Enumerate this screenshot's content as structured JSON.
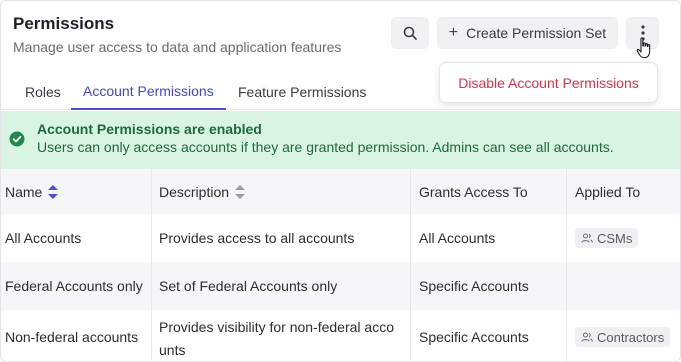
{
  "header": {
    "title": "Permissions",
    "subtitle": "Manage user access to data and application features",
    "create_label": "Create Permission Set"
  },
  "menu": {
    "disable_label": "Disable Account Permissions"
  },
  "tabs": [
    {
      "label": "Roles",
      "active": false
    },
    {
      "label": "Account Permissions",
      "active": true
    },
    {
      "label": "Feature Permissions",
      "active": false
    }
  ],
  "banner": {
    "title": "Account Permissions are enabled",
    "text": "Users can only access accounts if they are granted permission. Admins can see all accounts."
  },
  "table": {
    "columns": [
      "Name",
      "Description",
      "Grants Access To",
      "Applied To"
    ],
    "rows": [
      {
        "name": "All Accounts",
        "description": "Provides access to all accounts",
        "grants": "All Accounts",
        "applied": "CSMs"
      },
      {
        "name": "Federal Accounts only",
        "description": "Set of Federal Accounts only",
        "grants": "Specific Accounts",
        "applied": ""
      },
      {
        "name": "Non-federal accounts",
        "description_line1": "Provides visibility for non-federal acco",
        "description_line2": "unts",
        "grants": "Specific Accounts",
        "applied": "Contractors"
      }
    ]
  },
  "colors": {
    "accent": "#4a50c9",
    "danger": "#d3374a",
    "success_bg": "#d9f4e3",
    "success_text": "#1d6a3c"
  },
  "icons": {
    "search": "search-icon",
    "plus": "plus-icon",
    "more": "more-vertical-icon",
    "cursor": "hand-pointer-icon",
    "check": "check-circle-icon",
    "users": "users-icon",
    "sort": "sort-icon"
  }
}
